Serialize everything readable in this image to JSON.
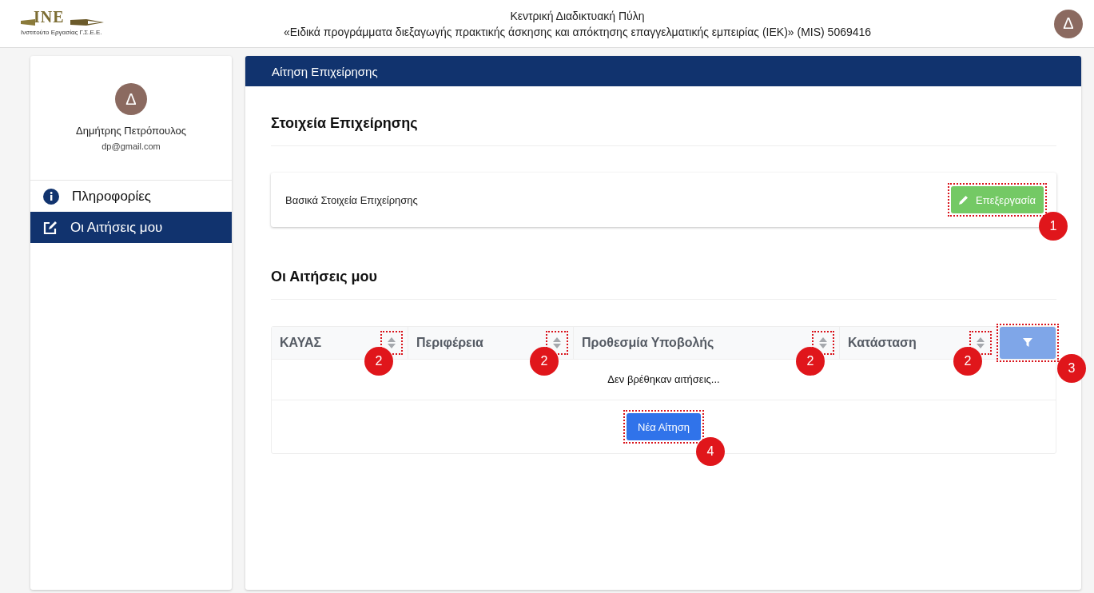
{
  "header": {
    "logo_text": "INE",
    "logo_caption": "Ινστιτούτο Εργασίας Γ.Σ.Ε.Ε.",
    "title": "Κεντρική Διαδικτυακή Πύλη",
    "subtitle": "«Ειδικά προγράμματα διεξαγωγής πρακτικής άσκησης και απόκτησης επαγγελματικής εμπειρίας (ΙΕΚ)» (MIS) 5069416",
    "avatar": "Δ"
  },
  "sidebar": {
    "avatar": "Δ",
    "name": "Δημήτρης Πετρόπουλος",
    "email": "dp@gmail.com",
    "items": [
      {
        "label": "Πληροφορίες",
        "kind": "info",
        "selected": false
      },
      {
        "label": "Οι Αιτήσεις μου",
        "kind": "edit",
        "selected": true
      }
    ]
  },
  "panel": {
    "title": "Αίτηση Επιχείρησης",
    "business": {
      "heading": "Στοιχεία Επιχείρησης",
      "card_label": "Βασικά Στοιχεία Επιχείρησης",
      "edit_button": "Επεξεργασία",
      "callout": "1"
    },
    "applications": {
      "heading": "Οι Αιτήσεις μου",
      "columns": [
        {
          "label": "ΚΑΥΑΣ",
          "callout": "2"
        },
        {
          "label": "Περιφέρεια",
          "callout": "2"
        },
        {
          "label": "Προθεσμία Υποβολής",
          "callout": "2"
        },
        {
          "label": "Κατάσταση",
          "callout": "2"
        }
      ],
      "filter_callout": "3",
      "empty": "Δεν βρέθηκαν αιτήσεις...",
      "new_button": "Νέα Αίτηση",
      "new_callout": "4"
    }
  }
}
